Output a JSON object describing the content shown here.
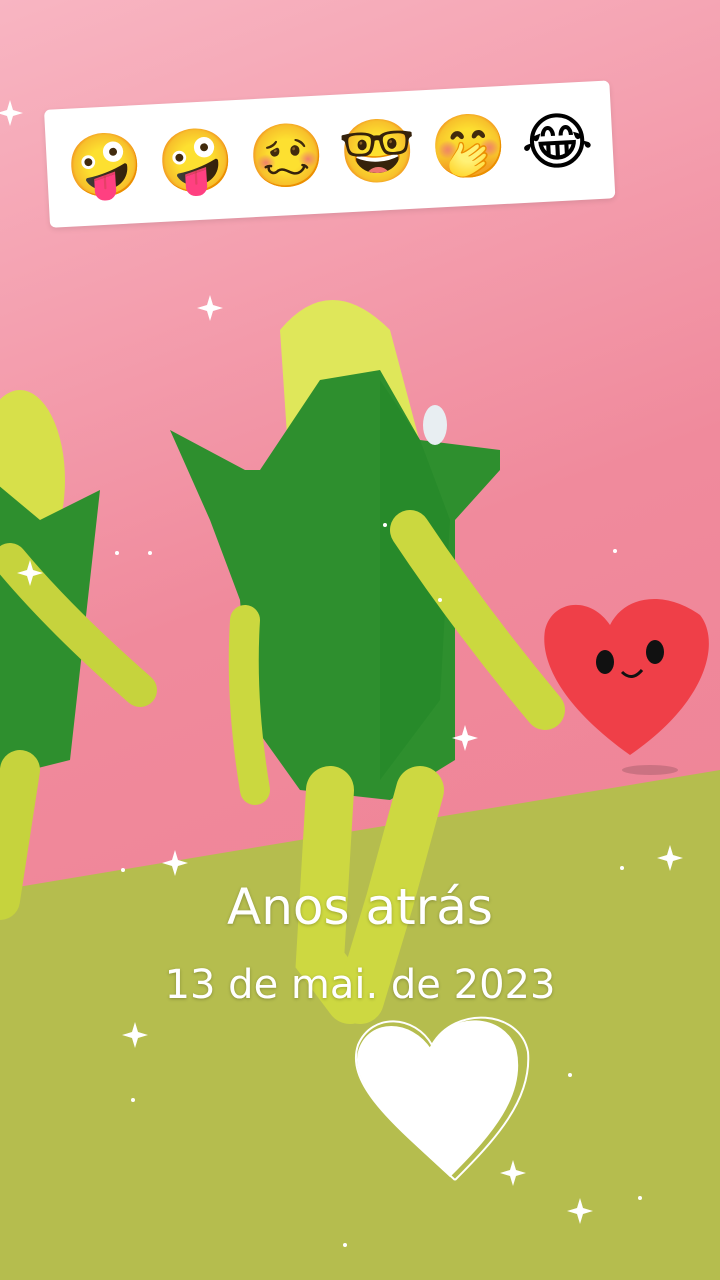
{
  "emoji_bar": {
    "emojis": [
      "🤪",
      "🤪",
      "🥴",
      "🤓",
      "🤭",
      "😂"
    ]
  },
  "overlay": {
    "title": "Anos atrás",
    "date": "13 de mai. de 2023"
  },
  "colors": {
    "background_pink": "#f08a9c",
    "ground_green": "#b5bd4e",
    "character_green": "#2e8f2e",
    "character_yellow": "#d7e04a",
    "heart_red": "#ef3f48",
    "text_white": "#ffffff"
  }
}
